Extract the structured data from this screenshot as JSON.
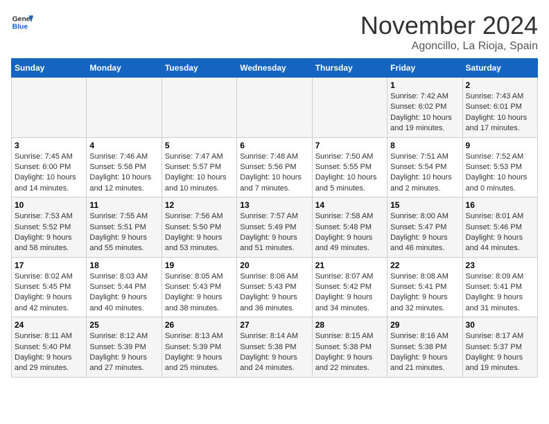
{
  "header": {
    "logo_line1": "General",
    "logo_line2": "Blue",
    "month": "November 2024",
    "location": "Agoncillo, La Rioja, Spain"
  },
  "weekdays": [
    "Sunday",
    "Monday",
    "Tuesday",
    "Wednesday",
    "Thursday",
    "Friday",
    "Saturday"
  ],
  "weeks": [
    [
      {
        "day": "",
        "info": ""
      },
      {
        "day": "",
        "info": ""
      },
      {
        "day": "",
        "info": ""
      },
      {
        "day": "",
        "info": ""
      },
      {
        "day": "",
        "info": ""
      },
      {
        "day": "1",
        "info": "Sunrise: 7:42 AM\nSunset: 6:02 PM\nDaylight: 10 hours and 19 minutes."
      },
      {
        "day": "2",
        "info": "Sunrise: 7:43 AM\nSunset: 6:01 PM\nDaylight: 10 hours and 17 minutes."
      }
    ],
    [
      {
        "day": "3",
        "info": "Sunrise: 7:45 AM\nSunset: 6:00 PM\nDaylight: 10 hours and 14 minutes."
      },
      {
        "day": "4",
        "info": "Sunrise: 7:46 AM\nSunset: 5:58 PM\nDaylight: 10 hours and 12 minutes."
      },
      {
        "day": "5",
        "info": "Sunrise: 7:47 AM\nSunset: 5:57 PM\nDaylight: 10 hours and 10 minutes."
      },
      {
        "day": "6",
        "info": "Sunrise: 7:48 AM\nSunset: 5:56 PM\nDaylight: 10 hours and 7 minutes."
      },
      {
        "day": "7",
        "info": "Sunrise: 7:50 AM\nSunset: 5:55 PM\nDaylight: 10 hours and 5 minutes."
      },
      {
        "day": "8",
        "info": "Sunrise: 7:51 AM\nSunset: 5:54 PM\nDaylight: 10 hours and 2 minutes."
      },
      {
        "day": "9",
        "info": "Sunrise: 7:52 AM\nSunset: 5:53 PM\nDaylight: 10 hours and 0 minutes."
      }
    ],
    [
      {
        "day": "10",
        "info": "Sunrise: 7:53 AM\nSunset: 5:52 PM\nDaylight: 9 hours and 58 minutes."
      },
      {
        "day": "11",
        "info": "Sunrise: 7:55 AM\nSunset: 5:51 PM\nDaylight: 9 hours and 55 minutes."
      },
      {
        "day": "12",
        "info": "Sunrise: 7:56 AM\nSunset: 5:50 PM\nDaylight: 9 hours and 53 minutes."
      },
      {
        "day": "13",
        "info": "Sunrise: 7:57 AM\nSunset: 5:49 PM\nDaylight: 9 hours and 51 minutes."
      },
      {
        "day": "14",
        "info": "Sunrise: 7:58 AM\nSunset: 5:48 PM\nDaylight: 9 hours and 49 minutes."
      },
      {
        "day": "15",
        "info": "Sunrise: 8:00 AM\nSunset: 5:47 PM\nDaylight: 9 hours and 46 minutes."
      },
      {
        "day": "16",
        "info": "Sunrise: 8:01 AM\nSunset: 5:46 PM\nDaylight: 9 hours and 44 minutes."
      }
    ],
    [
      {
        "day": "17",
        "info": "Sunrise: 8:02 AM\nSunset: 5:45 PM\nDaylight: 9 hours and 42 minutes."
      },
      {
        "day": "18",
        "info": "Sunrise: 8:03 AM\nSunset: 5:44 PM\nDaylight: 9 hours and 40 minutes."
      },
      {
        "day": "19",
        "info": "Sunrise: 8:05 AM\nSunset: 5:43 PM\nDaylight: 9 hours and 38 minutes."
      },
      {
        "day": "20",
        "info": "Sunrise: 8:06 AM\nSunset: 5:43 PM\nDaylight: 9 hours and 36 minutes."
      },
      {
        "day": "21",
        "info": "Sunrise: 8:07 AM\nSunset: 5:42 PM\nDaylight: 9 hours and 34 minutes."
      },
      {
        "day": "22",
        "info": "Sunrise: 8:08 AM\nSunset: 5:41 PM\nDaylight: 9 hours and 32 minutes."
      },
      {
        "day": "23",
        "info": "Sunrise: 8:09 AM\nSunset: 5:41 PM\nDaylight: 9 hours and 31 minutes."
      }
    ],
    [
      {
        "day": "24",
        "info": "Sunrise: 8:11 AM\nSunset: 5:40 PM\nDaylight: 9 hours and 29 minutes."
      },
      {
        "day": "25",
        "info": "Sunrise: 8:12 AM\nSunset: 5:39 PM\nDaylight: 9 hours and 27 minutes."
      },
      {
        "day": "26",
        "info": "Sunrise: 8:13 AM\nSunset: 5:39 PM\nDaylight: 9 hours and 25 minutes."
      },
      {
        "day": "27",
        "info": "Sunrise: 8:14 AM\nSunset: 5:38 PM\nDaylight: 9 hours and 24 minutes."
      },
      {
        "day": "28",
        "info": "Sunrise: 8:15 AM\nSunset: 5:38 PM\nDaylight: 9 hours and 22 minutes."
      },
      {
        "day": "29",
        "info": "Sunrise: 8:16 AM\nSunset: 5:38 PM\nDaylight: 9 hours and 21 minutes."
      },
      {
        "day": "30",
        "info": "Sunrise: 8:17 AM\nSunset: 5:37 PM\nDaylight: 9 hours and 19 minutes."
      }
    ]
  ]
}
